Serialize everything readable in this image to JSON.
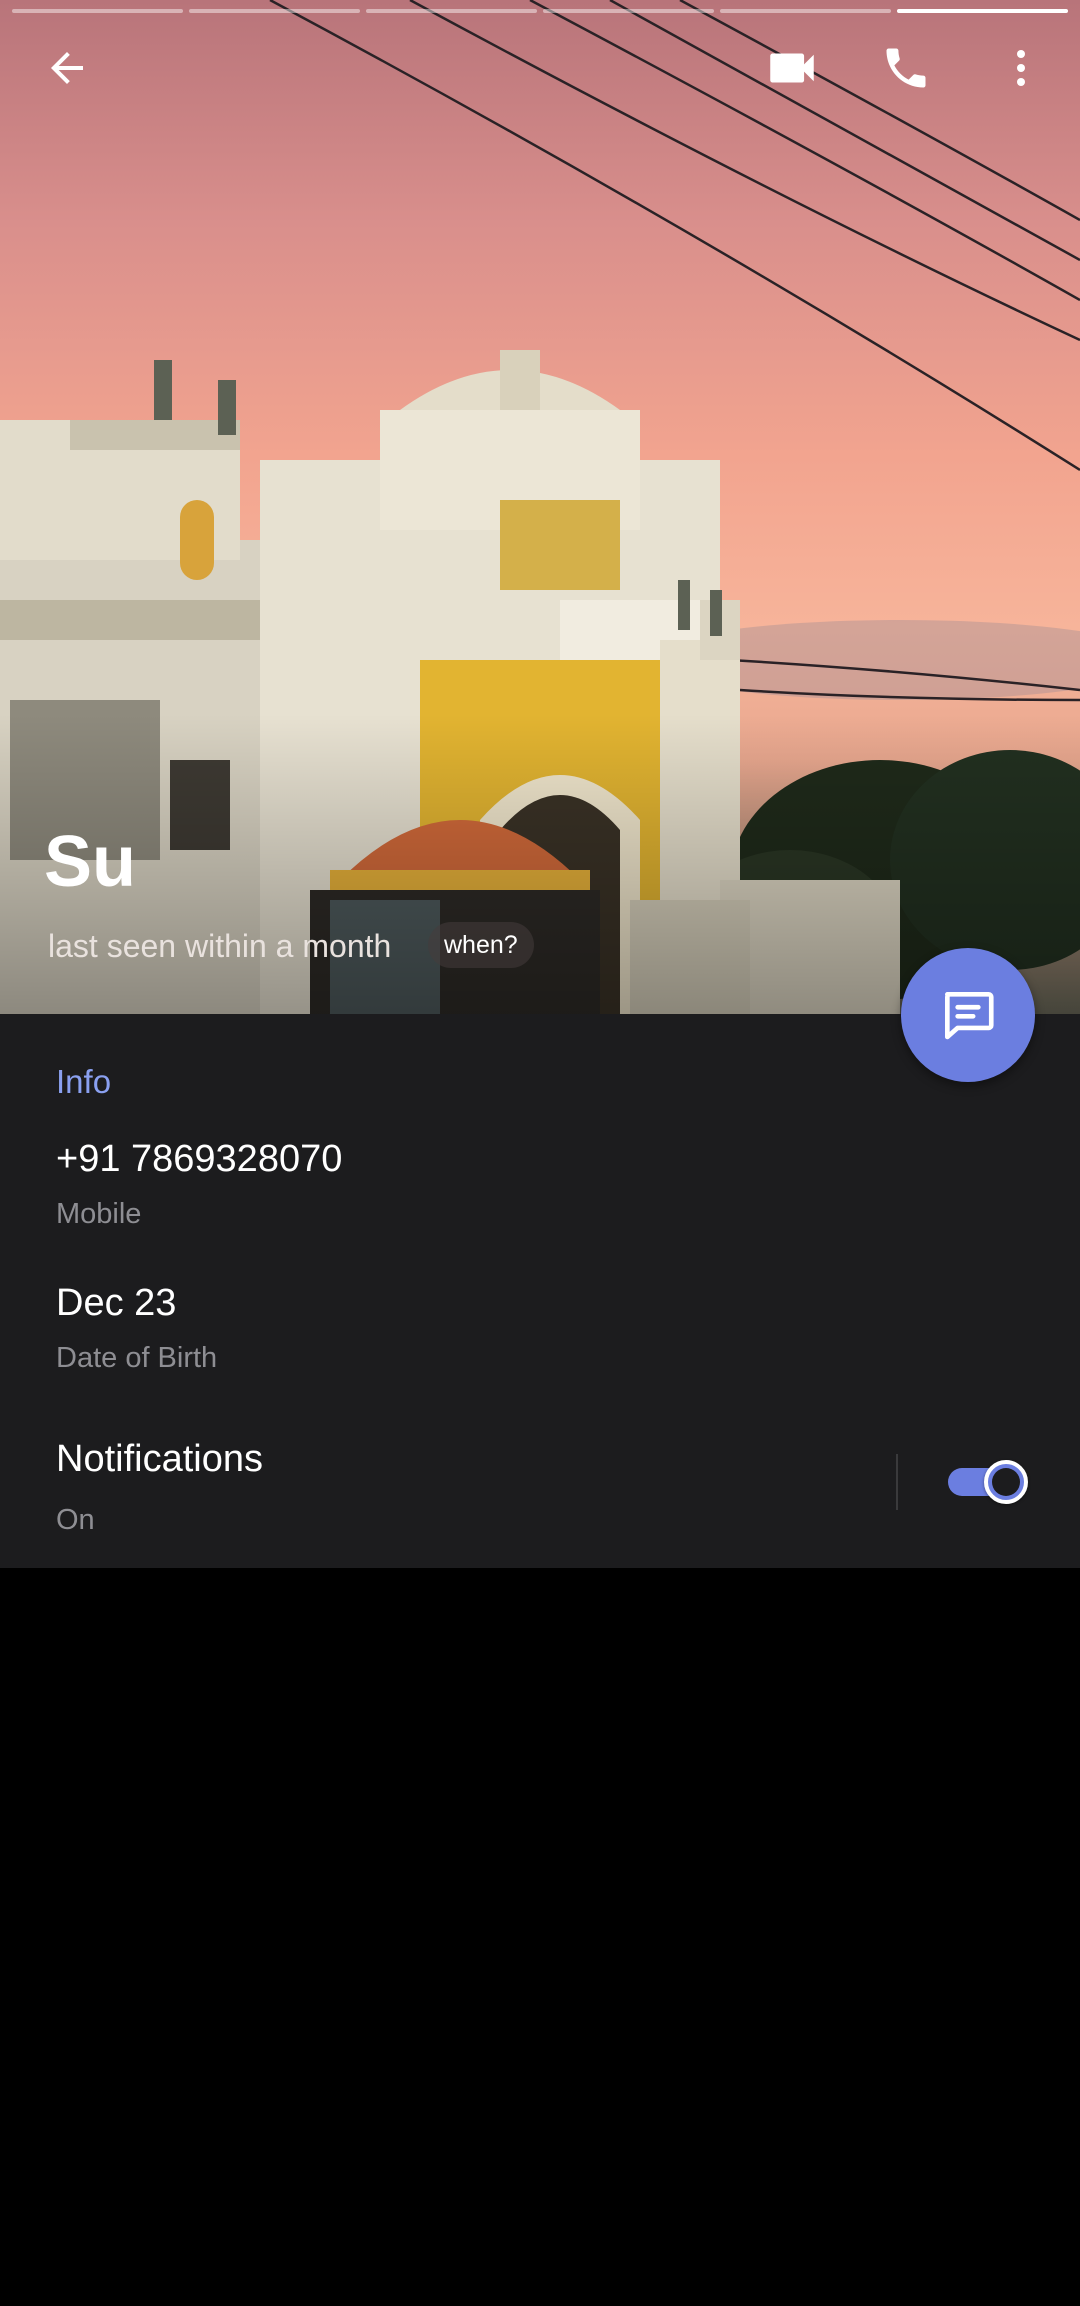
{
  "story": {
    "segments": 6,
    "active_index": 5
  },
  "header": {
    "back_icon": "arrow-left-icon",
    "video_icon": "video-camera-icon",
    "call_icon": "phone-icon",
    "more_icon": "more-vertical-icon"
  },
  "profile": {
    "name": "Su",
    "status": "last seen within a month",
    "when_label": "when?"
  },
  "fab": {
    "icon": "message-icon",
    "color": "#6b7ee0"
  },
  "info": {
    "title": "Info",
    "phone": "+91 7869328070",
    "phone_label": "Mobile",
    "birthday": "Dec 23",
    "birthday_label": "Date of Birth",
    "notifications_title": "Notifications",
    "notifications_state": "On",
    "notifications_enabled": true
  },
  "colors": {
    "accent": "#6b7ee0",
    "section_title": "#8aa0f0",
    "panel_bg": "#1c1c1e",
    "secondary_text": "#8e8e93"
  }
}
